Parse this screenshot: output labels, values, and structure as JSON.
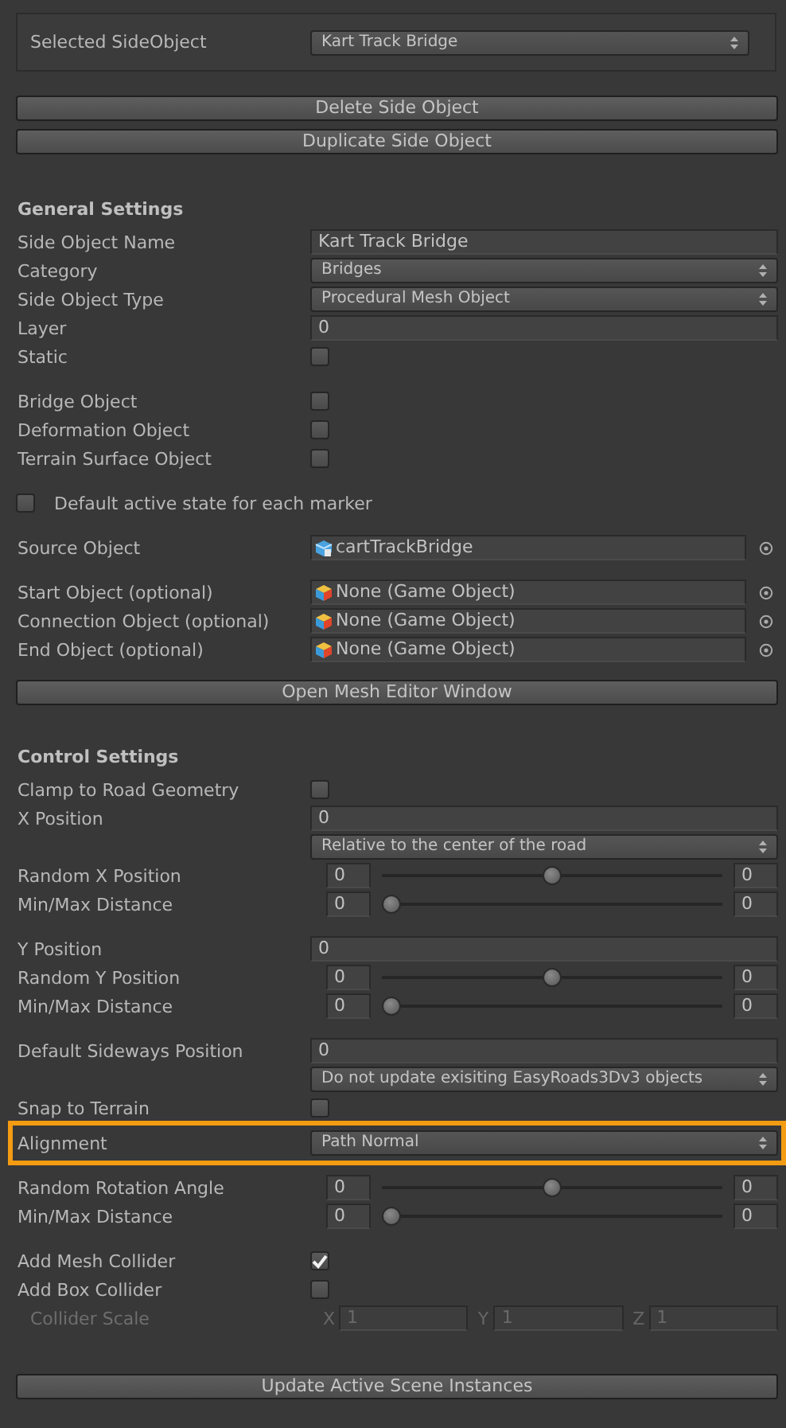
{
  "selector": {
    "label": "Selected SideObject",
    "value": "Kart Track Bridge"
  },
  "top_buttons": [
    "Delete Side Object",
    "Duplicate Side Object"
  ],
  "sections": [
    {
      "title": "General Settings",
      "groups": [
        [
          {
            "kind": "text",
            "label": "Side Object Name",
            "value": "Kart Track Bridge"
          },
          {
            "kind": "dropdown",
            "label": "Category",
            "value": "Bridges"
          },
          {
            "kind": "dropdown",
            "label": "Side Object Type",
            "value": "Procedural Mesh Object"
          },
          {
            "kind": "text",
            "label": "Layer",
            "value": "0"
          },
          {
            "kind": "checkbox",
            "label": "Static",
            "checked": false
          }
        ],
        [
          {
            "kind": "checkbox",
            "label": "Bridge Object",
            "checked": false
          },
          {
            "kind": "checkbox",
            "label": "Deformation Object",
            "checked": false
          },
          {
            "kind": "checkbox",
            "label": "Terrain Surface Object",
            "checked": false
          }
        ],
        [
          {
            "kind": "checkbox_left",
            "label": "Default active state for each marker",
            "checked": false
          }
        ],
        [
          {
            "kind": "prefab",
            "label": "Source Object",
            "value": "cartTrackBridge"
          }
        ],
        [
          {
            "kind": "gameobject",
            "label": "Start Object (optional)",
            "value": "None (Game Object)"
          },
          {
            "kind": "gameobject",
            "label": "Connection Object (optional)",
            "value": "None (Game Object)"
          },
          {
            "kind": "gameobject",
            "label": "End Object (optional)",
            "value": "None (Game Object)"
          }
        ],
        [
          {
            "kind": "button",
            "label": "Open Mesh Editor Window"
          }
        ]
      ]
    },
    {
      "title": "Control Settings",
      "groups": [
        [
          {
            "kind": "checkbox",
            "label": "Clamp to Road Geometry",
            "checked": false
          },
          {
            "kind": "text",
            "label": "X Position",
            "value": "0"
          },
          {
            "kind": "dropdown",
            "value": "Relative to the center of the road"
          },
          {
            "kind": "minmax",
            "label": "Random X Position",
            "min": "0",
            "max": "0",
            "level": 0.5
          },
          {
            "kind": "minmax",
            "label": "Min/Max Distance",
            "min": "0",
            "max": "0",
            "level": 0
          }
        ],
        [
          {
            "kind": "text",
            "label": "Y Position",
            "value": "0"
          },
          {
            "kind": "minmax",
            "label": "Random Y Position",
            "min": "0",
            "max": "0",
            "level": 0.5
          },
          {
            "kind": "minmax",
            "label": "Min/Max Distance",
            "min": "0",
            "max": "0",
            "level": 0
          }
        ],
        [
          {
            "kind": "text",
            "label": "Default Sideways Position",
            "value": "0"
          },
          {
            "kind": "dropdown",
            "value": "Do not update exisiting EasyRoads3Dv3 objects"
          },
          {
            "kind": "checkbox",
            "label": "Snap to Terrain",
            "checked": false
          },
          {
            "kind": "dropdown",
            "label": "Alignment",
            "value": "Path Normal",
            "highlighted": true
          }
        ],
        [
          {
            "kind": "minmax",
            "label": "Random Rotation Angle",
            "min": "0",
            "max": "0",
            "level": 0.5
          },
          {
            "kind": "minmax",
            "label": "Min/Max Distance",
            "min": "0",
            "max": "0",
            "level": 0
          }
        ],
        [
          {
            "kind": "checkbox",
            "label": "Add Mesh Collider",
            "checked": true
          },
          {
            "kind": "checkbox",
            "label": "Add Box Collider",
            "checked": false
          },
          {
            "kind": "vector",
            "label": "Collider Scale",
            "disabled": true,
            "fields": [
              {
                "axis": "X",
                "value": "1"
              },
              {
                "axis": "Y",
                "value": "1"
              },
              {
                "axis": "Z",
                "value": "1"
              }
            ]
          }
        ]
      ]
    }
  ],
  "bottom_button": "Update Active Scene Instances"
}
